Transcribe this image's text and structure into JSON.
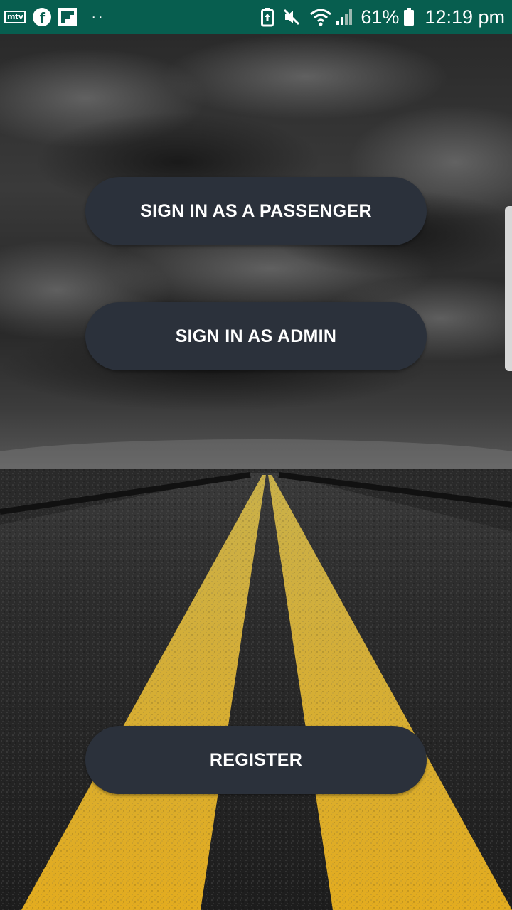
{
  "status_bar": {
    "app_icons": [
      "mtv-icon",
      "facebook-icon",
      "flipboard-icon",
      "more-notifications-icon"
    ],
    "mtv_label": "mtv",
    "facebook_glyph": "f",
    "dots": "··",
    "battery_percent": "61%",
    "time": "12:19 pm",
    "background_color": "#075e4f"
  },
  "buttons": {
    "passenger_label": "SIGN IN AS A PASSENGER",
    "admin_label": "SIGN IN AS ADMIN",
    "register_label": "REGISTER",
    "background_color": "#2b313b"
  },
  "background": {
    "description_icon": "road-storm-background"
  }
}
